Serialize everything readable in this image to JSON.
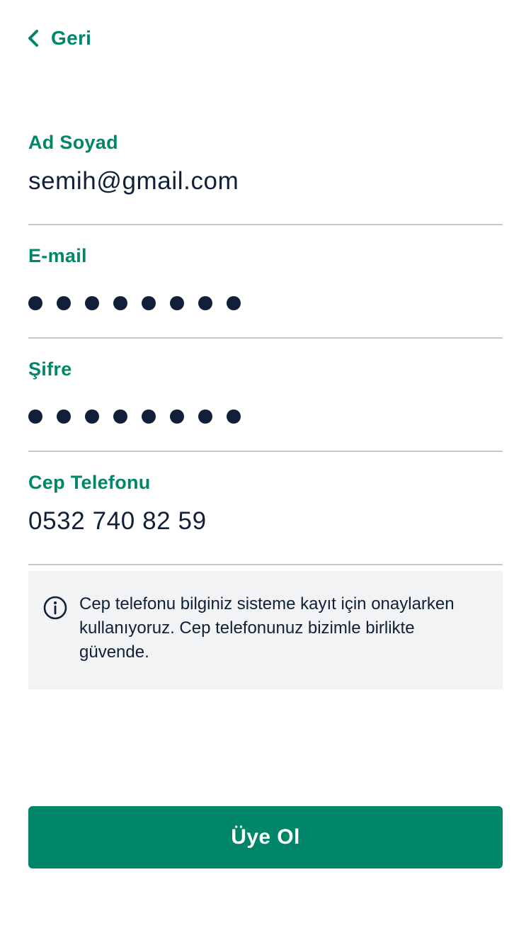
{
  "header": {
    "back_label": "Geri",
    "back_icon": "chevron-left-icon"
  },
  "form": {
    "fields": [
      {
        "label": "Ad Soyad",
        "value": "semih@gmail.com",
        "masked": false
      },
      {
        "label": "E-mail",
        "value": "",
        "masked": true,
        "mask_count": 8
      },
      {
        "label": "Şifre",
        "value": "",
        "masked": true,
        "mask_count": 8
      },
      {
        "label": "Cep Telefonu",
        "value": "0532 740 82 59",
        "masked": false
      }
    ]
  },
  "info": {
    "icon": "info-icon",
    "text": "Cep telefonu bilginiz sisteme kayıt için onaylarken kullanıyoruz. Cep telefonunuz bizimle birlikte güvende."
  },
  "submit": {
    "label": "Üye Ol"
  },
  "colors": {
    "accent": "#00876a",
    "text": "#0f2038",
    "divider": "#c7ccd3",
    "info_bg": "#f2f3f5"
  }
}
